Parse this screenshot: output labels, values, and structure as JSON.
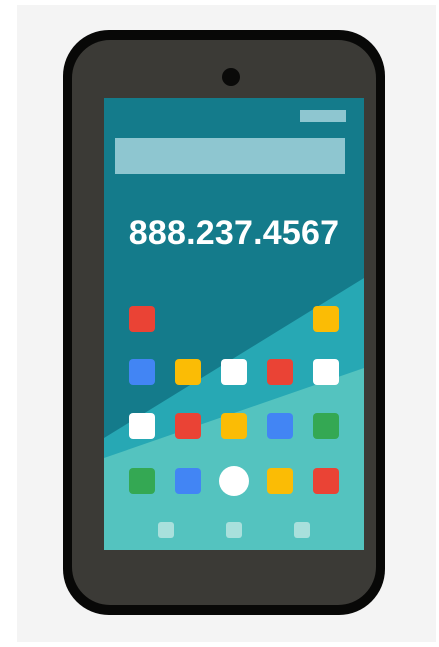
{
  "screen": {
    "phone_number": "888.237.4567"
  },
  "colors": {
    "red": "#ea4335",
    "yellow": "#fbbc05",
    "blue": "#4285f4",
    "green": "#34a853",
    "white": "#ffffff",
    "phone_body": "#3b3a36",
    "phone_rim": "#080807",
    "screen_dark": "#147b8b",
    "screen_mid": "#27a8b4",
    "screen_light": "#54c3bf"
  },
  "app_icons": [
    [
      "red",
      null,
      null,
      null,
      "yellow"
    ],
    [
      "blue",
      "yellow",
      "white",
      "red",
      "white"
    ],
    [
      "white",
      "red",
      "yellow",
      "blue",
      "green"
    ],
    [
      "green",
      "blue",
      "white-circle",
      "yellow",
      "red"
    ]
  ],
  "dock_icon_count": 3
}
